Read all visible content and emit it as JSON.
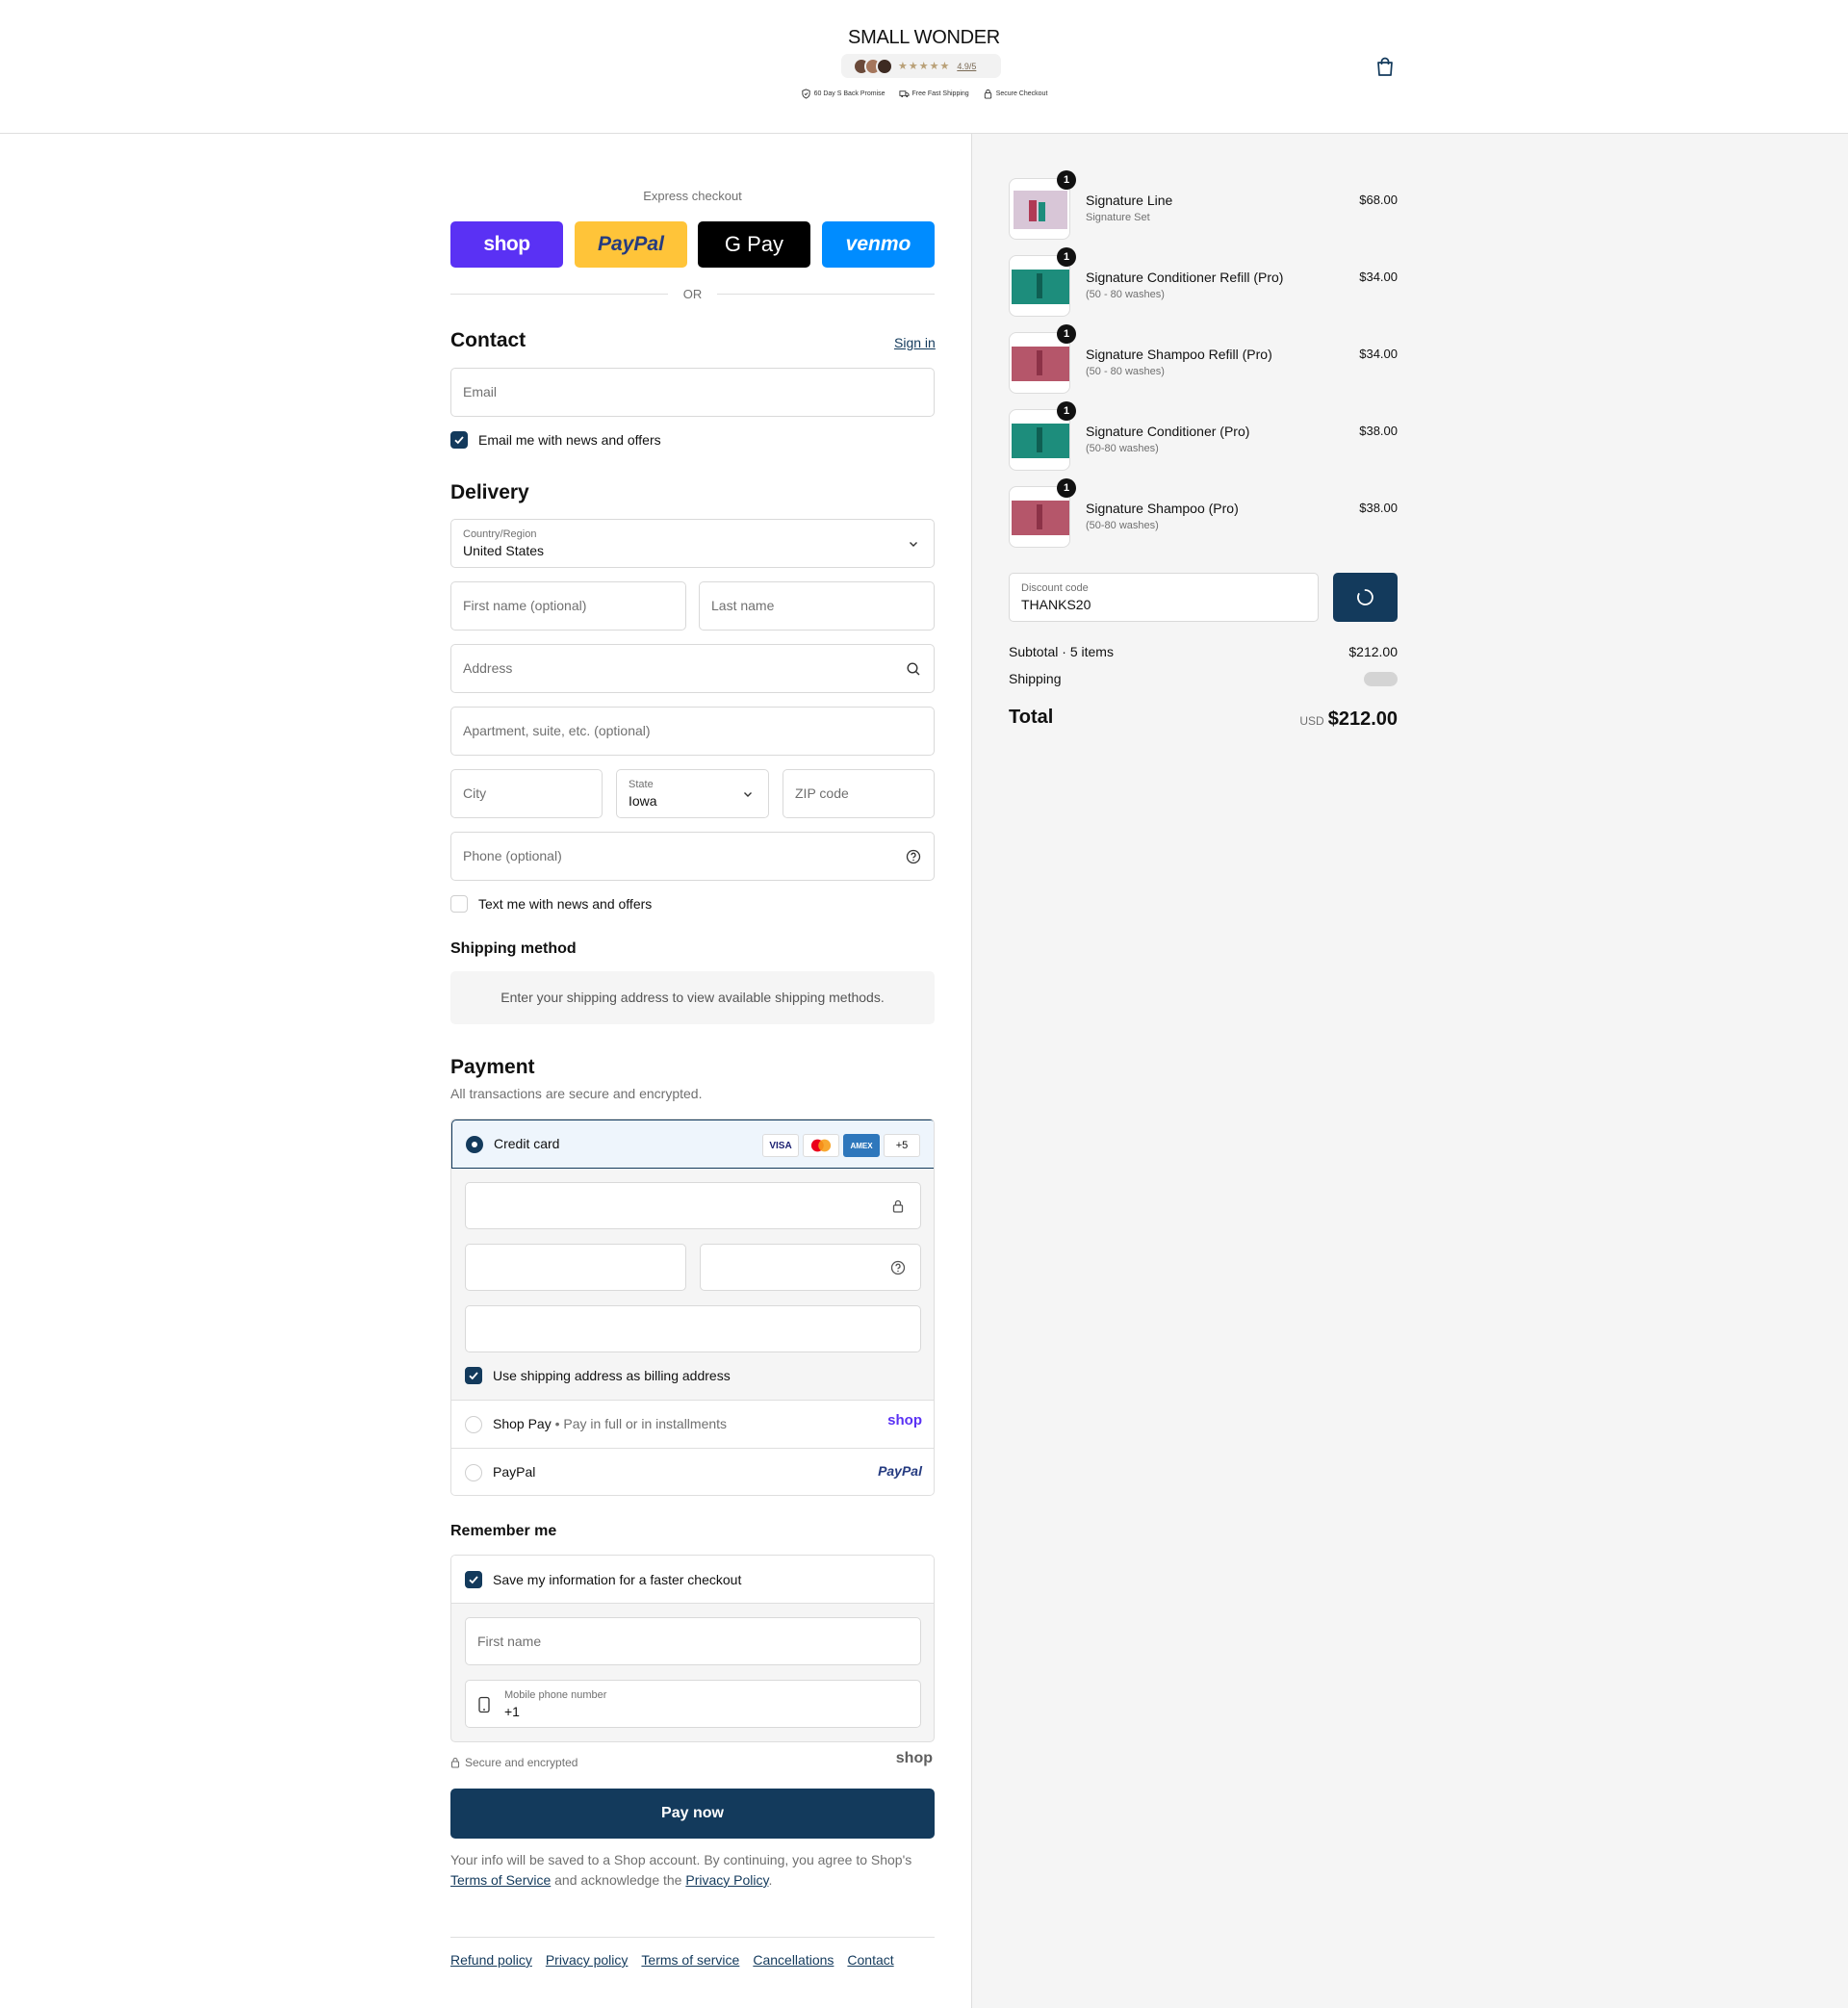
{
  "header": {
    "brand": "SMALL WONDER",
    "rating_value": "4.9/5",
    "badges": [
      "60 Day S Back Promise",
      "Free Fast Shipping",
      "Secure Checkout"
    ]
  },
  "express": {
    "title": "Express checkout",
    "buttons": [
      "shop",
      "PayPal",
      "G Pay",
      "venmo"
    ],
    "or_label": "OR"
  },
  "contact": {
    "heading": "Contact",
    "sign_in": "Sign in",
    "email_placeholder": "Email",
    "news_checkbox": "Email me with news and offers",
    "news_checked": true
  },
  "delivery": {
    "heading": "Delivery",
    "country_label": "Country/Region",
    "country_value": "United States",
    "first_name_placeholder": "First name (optional)",
    "last_name_placeholder": "Last name",
    "address_placeholder": "Address",
    "apartment_placeholder": "Apartment, suite, etc. (optional)",
    "city_placeholder": "City",
    "state_label": "State",
    "state_value": "Iowa",
    "zip_placeholder": "ZIP code",
    "phone_placeholder": "Phone (optional)",
    "text_checkbox": "Text me with news and offers",
    "text_checked": false
  },
  "shipping_method": {
    "heading": "Shipping method",
    "message": "Enter your shipping address to view available shipping methods."
  },
  "payment": {
    "heading": "Payment",
    "subtitle": "All transactions are secure and encrypted.",
    "credit_card_label": "Credit card",
    "card_logos": [
      "VISA",
      "MC",
      "AMEX",
      "+5"
    ],
    "billing_checkbox": "Use shipping address as billing address",
    "billing_checked": true,
    "shop_pay_label": "Shop Pay",
    "shop_pay_sub": "Pay in full or in installments",
    "shop_pay_logo": "shop",
    "paypal_label": "PayPal",
    "paypal_logo": "PayPal"
  },
  "remember": {
    "heading": "Remember me",
    "save_checkbox": "Save my information for a faster checkout",
    "save_checked": true,
    "first_name_placeholder": "First name",
    "mobile_label": "Mobile phone number",
    "mobile_value": "+1"
  },
  "secure": {
    "label": "Secure and encrypted",
    "shop_logo": "shop"
  },
  "pay_now": "Pay now",
  "legal": {
    "text1": "Your info will be saved to a Shop account. By continuing, you agree to Shop's",
    "terms": "Terms of Service",
    "text2": "and acknowledge the",
    "privacy": "Privacy Policy",
    "end": "."
  },
  "footer_links": [
    "Refund policy",
    "Privacy policy",
    "Terms of service",
    "Cancellations",
    "Contact"
  ],
  "summary": {
    "items": [
      {
        "name": "Signature Line",
        "variant": "Signature Set",
        "price": "$68.00",
        "qty": "1",
        "color": "#d9c9d8"
      },
      {
        "name": "Signature Conditioner Refill (Pro)",
        "variant": "(50 - 80 washes)",
        "price": "$34.00",
        "qty": "1",
        "color": "#1d8d7c"
      },
      {
        "name": "Signature Shampoo Refill (Pro)",
        "variant": "(50 - 80 washes)",
        "price": "$34.00",
        "qty": "1",
        "color": "#b5566a"
      },
      {
        "name": "Signature Conditioner (Pro)",
        "variant": "(50-80 washes)",
        "price": "$38.00",
        "qty": "1",
        "color": "#1d8d7c"
      },
      {
        "name": "Signature Shampoo (Pro)",
        "variant": "(50-80 washes)",
        "price": "$38.00",
        "qty": "1",
        "color": "#b5566a"
      }
    ],
    "discount_label": "Discount code",
    "discount_value": "THANKS20",
    "subtotal_label": "Subtotal · 5 items",
    "subtotal_value": "$212.00",
    "shipping_label": "Shipping",
    "total_label": "Total",
    "currency": "USD",
    "total_value": "$212.00"
  },
  "colors": {
    "primary": "#133a5c",
    "shop_purple": "#5a31f4",
    "paypal_yellow": "#ffc439",
    "venmo_blue": "#008cff"
  }
}
